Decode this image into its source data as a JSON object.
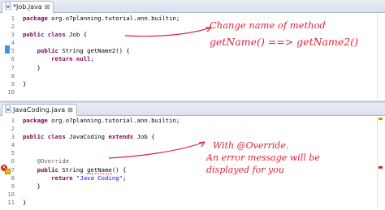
{
  "top_editor": {
    "tab_label": "*Job.java",
    "close_glyph": "⊠",
    "lines": [
      {
        "no": "1",
        "parts": [
          {
            "t": "package ",
            "c": "kw"
          },
          {
            "t": "org.o7planning.tutorial.ann.builtin;",
            "c": ""
          }
        ]
      },
      {
        "no": "2",
        "parts": []
      },
      {
        "no": "3",
        "parts": [
          {
            "t": "public ",
            "c": "kw"
          },
          {
            "t": "class ",
            "c": "kw"
          },
          {
            "t": "Job {",
            "c": ""
          }
        ]
      },
      {
        "no": "4",
        "parts": []
      },
      {
        "no": "5",
        "parts": [
          {
            "t": "    ",
            "c": ""
          },
          {
            "t": "public ",
            "c": "kw"
          },
          {
            "t": "String getName2() {",
            "c": ""
          }
        ]
      },
      {
        "no": "6",
        "parts": [
          {
            "t": "        ",
            "c": ""
          },
          {
            "t": "return ",
            "c": "kw"
          },
          {
            "t": "null",
            "c": "kw"
          },
          {
            "t": ";",
            "c": ""
          }
        ]
      },
      {
        "no": "7",
        "parts": [
          {
            "t": "    }",
            "c": ""
          }
        ]
      },
      {
        "no": "8",
        "parts": []
      },
      {
        "no": "9",
        "parts": [
          {
            "t": "}",
            "c": ""
          }
        ]
      },
      {
        "no": "10",
        "parts": []
      }
    ],
    "note_line1": "Change name of method",
    "note_line2": "getName() ==> getName2()"
  },
  "bottom_editor": {
    "tab_label": "JavaCoding.java",
    "close_glyph": "⊠",
    "lines": [
      {
        "no": "1",
        "parts": [
          {
            "t": "package ",
            "c": "kw"
          },
          {
            "t": "org.o7planning.tutorial.ann.builtin;",
            "c": ""
          }
        ]
      },
      {
        "no": "2",
        "parts": []
      },
      {
        "no": "3",
        "parts": [
          {
            "t": "public ",
            "c": "kw"
          },
          {
            "t": "class ",
            "c": "kw"
          },
          {
            "t": "JavaCoding ",
            "c": ""
          },
          {
            "t": "extends ",
            "c": "kw"
          },
          {
            "t": "Job {",
            "c": ""
          }
        ]
      },
      {
        "no": "4",
        "parts": []
      },
      {
        "no": "5",
        "parts": []
      },
      {
        "no": "6",
        "parts": [
          {
            "t": "    ",
            "c": ""
          },
          {
            "t": "@Override",
            "c": "ann"
          }
        ]
      },
      {
        "no": "7",
        "parts": [
          {
            "t": "    ",
            "c": ""
          },
          {
            "t": "public ",
            "c": "kw"
          },
          {
            "t": "String ",
            "c": ""
          },
          {
            "t": "getName",
            "c": "err"
          },
          {
            "t": "() {",
            "c": ""
          }
        ]
      },
      {
        "no": "8",
        "parts": [
          {
            "t": "        ",
            "c": ""
          },
          {
            "t": "return ",
            "c": "kw"
          },
          {
            "t": "\"Java Coding\"",
            "c": "str"
          },
          {
            "t": ";",
            "c": ""
          }
        ]
      },
      {
        "no": "9",
        "parts": [
          {
            "t": "    }",
            "c": ""
          }
        ]
      },
      {
        "no": "10",
        "parts": []
      },
      {
        "no": "11",
        "parts": [
          {
            "t": "}",
            "c": ""
          }
        ]
      }
    ],
    "note_line1": "With @Override.",
    "note_line2": "An error message will be",
    "note_line3": "displayed for you"
  }
}
